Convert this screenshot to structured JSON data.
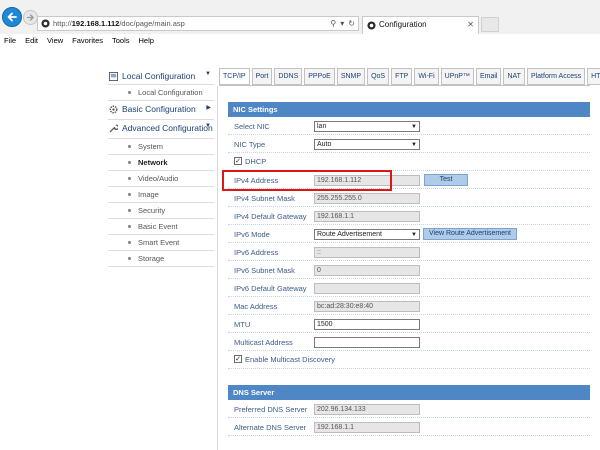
{
  "browser": {
    "url_prefix": "http://",
    "url_host": "192.168.1.112",
    "url_path": "/doc/page/main.asp",
    "tab_title": "Configuration",
    "menu": [
      "File",
      "Edit",
      "View",
      "Favorites",
      "Tools",
      "Help"
    ]
  },
  "sidebar": {
    "local_config": {
      "label": "Local Configuration",
      "items": [
        "Local Configuration"
      ]
    },
    "basic_config": {
      "label": "Basic Configuration"
    },
    "advanced_config": {
      "label": "Advanced Configuration",
      "items": [
        "System",
        "Network",
        "Video/Audio",
        "Image",
        "Security",
        "Basic Event",
        "Smart Event",
        "Storage"
      ],
      "active": "Network"
    }
  },
  "tabs": [
    "TCP/IP",
    "Port",
    "DDNS",
    "PPPoE",
    "SNMP",
    "QoS",
    "FTP",
    "Wi-Fi",
    "UPnP™",
    "Email",
    "NAT",
    "Platform Access",
    "HTTPS"
  ],
  "nic": {
    "header": "NIC Settings",
    "select_nic": {
      "label": "Select NIC",
      "value": "lan"
    },
    "nic_type": {
      "label": "NIC Type",
      "value": "Auto"
    },
    "dhcp": {
      "label": "DHCP",
      "checked": true
    },
    "ipv4_address": {
      "label": "IPv4 Address",
      "value": "192.168.1.112"
    },
    "test_button": "Test",
    "ipv4_mask": {
      "label": "IPv4 Subnet Mask",
      "value": "255.255.255.0"
    },
    "ipv4_gateway": {
      "label": "IPv4 Default Gateway",
      "value": "192.168.1.1"
    },
    "ipv6_mode": {
      "label": "IPv6 Mode",
      "value": "Route Advertisement"
    },
    "view_route_button": "View Route Advertisement",
    "ipv6_address": {
      "label": "IPv6 Address",
      "value": "::"
    },
    "ipv6_mask": {
      "label": "IPv6 Subnet Mask",
      "value": "0"
    },
    "ipv6_gateway": {
      "label": "IPv6 Default Gateway",
      "value": ""
    },
    "mac": {
      "label": "Mac Address",
      "value": "bc:ad:28:30:e8:40"
    },
    "mtu": {
      "label": "MTU",
      "value": "1500"
    },
    "multicast": {
      "label": "Multicast Address",
      "value": ""
    },
    "multicast_discovery": {
      "label": "Enable Multicast Discovery",
      "checked": true
    }
  },
  "dns": {
    "header": "DNS Server",
    "preferred": {
      "label": "Preferred DNS Server",
      "value": "202.96.134.133"
    },
    "alternate": {
      "label": "Alternate DNS Server",
      "value": "192.168.1.1"
    }
  },
  "colors": {
    "accent": "#4f86c6",
    "highlight": "#e01616",
    "nav_text": "#1c3f74"
  },
  "icons": [
    "back-arrow-icon",
    "forward-arrow-icon",
    "search-icon",
    "refresh-icon",
    "close-icon",
    "home-icon",
    "gear-icon",
    "wrench-icon",
    "checkmark-icon"
  ]
}
